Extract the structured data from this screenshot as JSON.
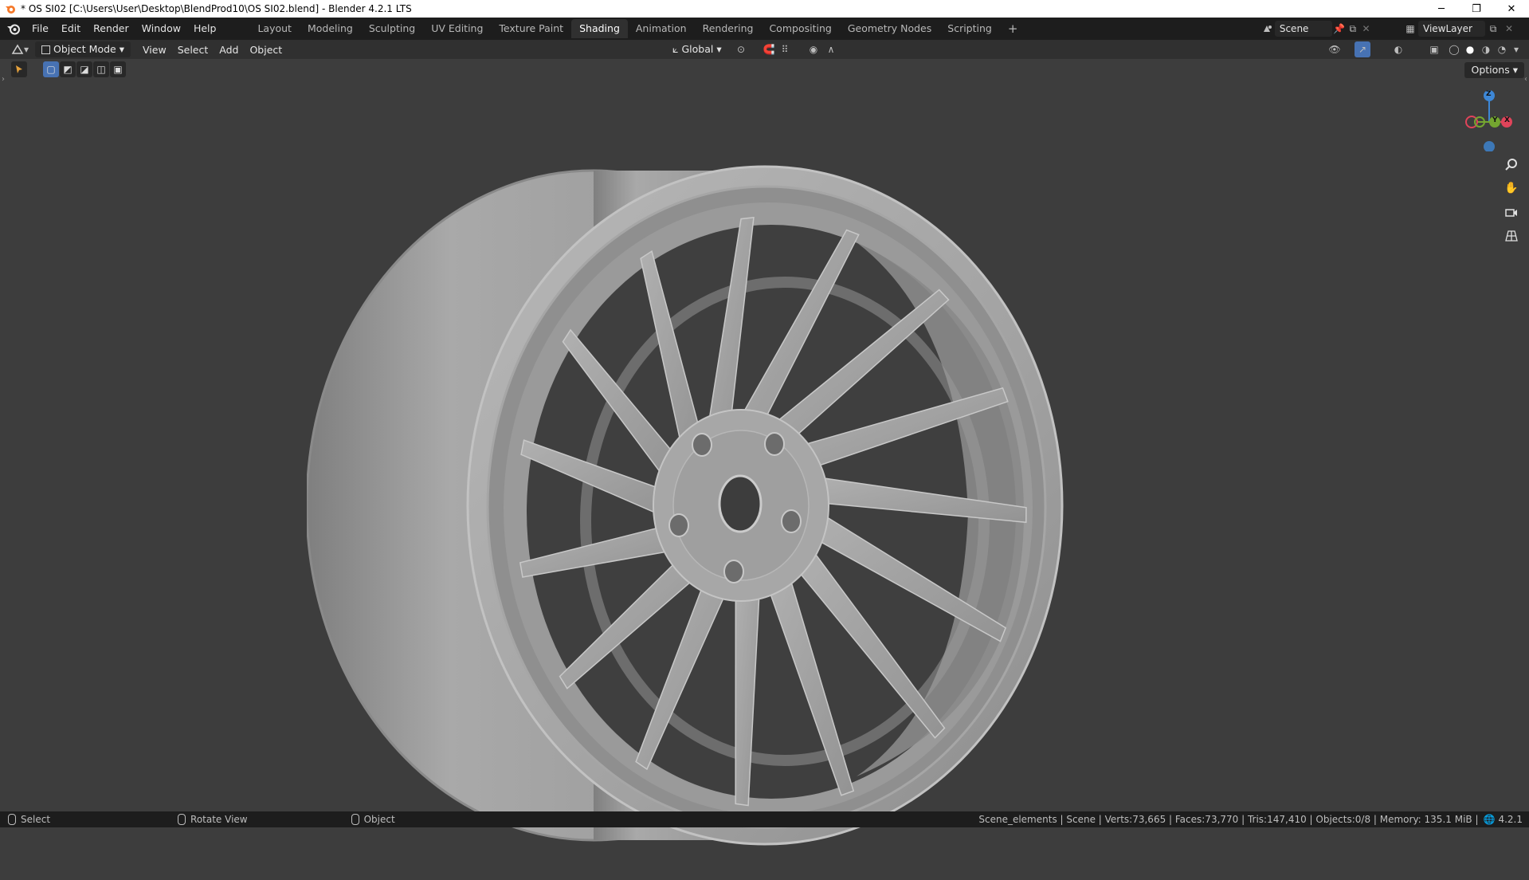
{
  "window": {
    "title": "* OS SI02 [C:\\Users\\User\\Desktop\\BlendProd10\\OS SI02.blend] - Blender 4.2.1 LTS",
    "controls": {
      "minimize": "─",
      "restore": "❐",
      "close": "✕"
    }
  },
  "topbar": {
    "menus": [
      "File",
      "Edit",
      "Render",
      "Window",
      "Help"
    ],
    "workspaces": [
      "Layout",
      "Modeling",
      "Sculpting",
      "UV Editing",
      "Texture Paint",
      "Shading",
      "Animation",
      "Rendering",
      "Compositing",
      "Geometry Nodes",
      "Scripting"
    ],
    "active_workspace": "Shading",
    "add_workspace": "+",
    "scene": "Scene",
    "view_layer": "ViewLayer"
  },
  "viewport_header": {
    "mode": "Object Mode",
    "menus": [
      "View",
      "Select",
      "Add",
      "Object"
    ],
    "transform_orientation": "Global",
    "options_label": "Options"
  },
  "gizmo": {
    "x": "X",
    "y": "Y",
    "z": "Z"
  },
  "statusbar": {
    "select": "Select",
    "rotate": "Rotate View",
    "object": "Object",
    "stats": "Scene_elements | Scene | Verts:73,665 | Faces:73,770 | Tris:147,410 | Objects:0/8 | Memory: 135.1 MiB |",
    "version": "4.2.1"
  },
  "colors": {
    "accent": "#4772b3",
    "axis_x": "#e0445a",
    "axis_y": "#74a630",
    "axis_z": "#3d87d6",
    "mesh": "#a8a8a8",
    "background": "#3d3d3d"
  }
}
